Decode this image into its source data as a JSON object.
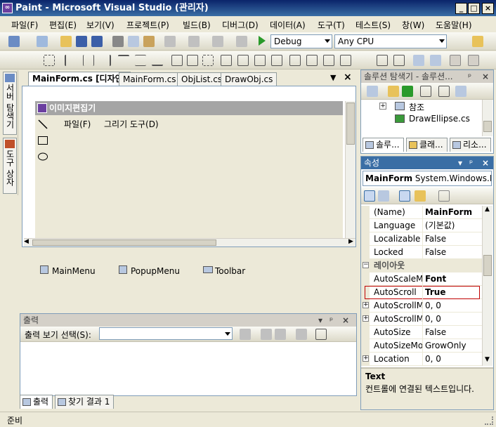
{
  "window": {
    "title": "Paint - Microsoft Visual Studio (관리자)",
    "app_icon": "visual-studio-icon"
  },
  "menu": [
    "파일(F)",
    "편집(E)",
    "보기(V)",
    "프로젝트(P)",
    "빌드(B)",
    "디버그(D)",
    "데이터(A)",
    "도구(T)",
    "테스트(S)",
    "창(W)",
    "도움말(H)"
  ],
  "toolbar": {
    "configuration": "Debug",
    "platform": "Any CPU"
  },
  "left_dock": {
    "server_explorer": "서버 탐색기",
    "toolbox": "도구 상자"
  },
  "editor": {
    "tabs": [
      "MainForm.cs [디자인]",
      "MainForm.cs",
      "ObjList.cs",
      "DrawObj.cs"
    ],
    "form": {
      "title": "이미지편집기",
      "menu": [
        "파일(F)",
        "그리기 도구(D)"
      ],
      "tool_icons": [
        "line-icon",
        "rectangle-icon",
        "ellipse-icon"
      ]
    },
    "tray": [
      "MainMenu",
      "PopupMenu",
      "Toolbar"
    ]
  },
  "output": {
    "title": "출력",
    "show_label": "출력 보기 선택(S):",
    "show_value": ""
  },
  "bottom_tabs": [
    "출력",
    "찾기 결과 1"
  ],
  "statusbar": {
    "text": "준비"
  },
  "solution_explorer": {
    "title": "솔루션 탐색기 - 솔루션...",
    "items": [
      {
        "label": "참조",
        "expander": "+"
      },
      {
        "label": "DrawEllipse.cs",
        "expander": ""
      }
    ],
    "tabs": [
      "솔루...",
      "클래...",
      "리소..."
    ]
  },
  "properties": {
    "title": "속성",
    "object": "MainForm",
    "object_type": "System.Windows.Fo",
    "rows": [
      {
        "name": "(Name)",
        "value": "MainForm",
        "bold": true,
        "expander": ""
      },
      {
        "name": "Language",
        "value": "(기본값)",
        "bold": false,
        "expander": ""
      },
      {
        "name": "Localizable",
        "value": "False",
        "bold": false,
        "expander": ""
      },
      {
        "name": "Locked",
        "value": "False",
        "bold": false,
        "expander": ""
      },
      {
        "category": "레이아웃",
        "expander": "−"
      },
      {
        "name": "AutoScaleMo",
        "value": "Font",
        "bold": true,
        "expander": ""
      },
      {
        "name": "AutoScroll",
        "value": "True",
        "bold": true,
        "expander": "",
        "selected": true
      },
      {
        "name": "AutoScrollMa",
        "value": "0, 0",
        "bold": false,
        "expander": "+"
      },
      {
        "name": "AutoScrollMi",
        "value": "0, 0",
        "bold": false,
        "expander": "+"
      },
      {
        "name": "AutoSize",
        "value": "False",
        "bold": false,
        "expander": ""
      },
      {
        "name": "AutoSizeMod",
        "value": "GrowOnly",
        "bold": false,
        "expander": ""
      },
      {
        "name": "Location",
        "value": "0, 0",
        "bold": false,
        "expander": "+"
      }
    ],
    "description_title": "Text",
    "description_text": "컨트롤에 연결된 텍스트입니다."
  },
  "colors": {
    "title_active": "#0a246a",
    "panel_title": "#3a6ea5",
    "chrome": "#ece9d8",
    "selection_border": "#c00000"
  }
}
